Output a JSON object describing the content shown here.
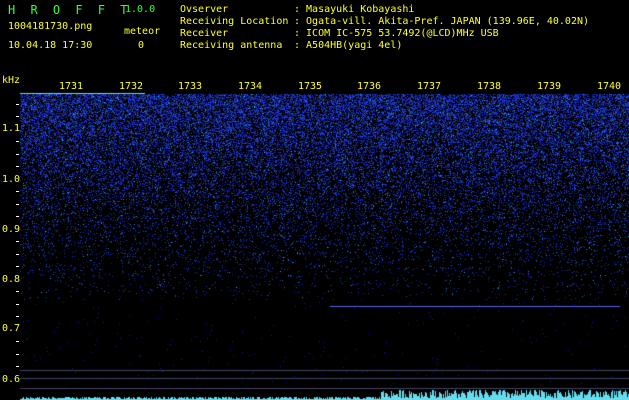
{
  "header": {
    "title": "H R O F F T",
    "version": "1.0.0",
    "filename": "1004181730.png",
    "datetime": "10.04.18 17:30",
    "meteor_label": "meteor",
    "meteor_count": "0"
  },
  "station_info": {
    "labels": [
      "Ovserver",
      "Receiving Location",
      "Receiver",
      "Receiving antenna"
    ],
    "values": [
      ": Masayuki Kobayashi",
      ": Ogata-vill. Akita-Pref. JAPAN (139.96E, 40.02N)",
      ": ICOM IC-575 53.7492(@LCD)MHz USB",
      ": A504HB(yagi 4el)"
    ]
  },
  "axis": {
    "unit": "kHz",
    "y_labels": [
      "1.1",
      "1.0",
      "0.9",
      "0.8",
      "0.7",
      "0.6"
    ],
    "minute_labels": [
      "1731",
      "1732",
      "1733",
      "1734",
      "1735",
      "1736",
      "1737",
      "1738",
      "1739",
      "1740"
    ]
  },
  "colors": {
    "noise": "#2233dd",
    "trace": "#66ddee",
    "text_green": "#33ff33",
    "text_yellow": "#ffff33"
  }
}
